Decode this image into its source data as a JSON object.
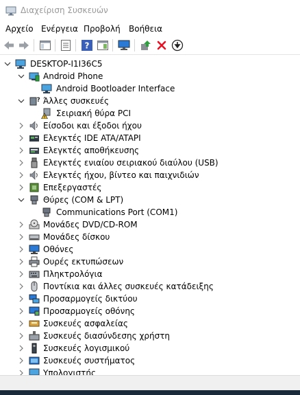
{
  "window": {
    "title": "Διαχείριση Συσκευών"
  },
  "menu": [
    "Αρχείο",
    "Ενέργεια",
    "Προβολή",
    "Βοήθεια"
  ],
  "toolbar": {
    "buttons": [
      "back-icon",
      "forward-icon",
      "tree-view-icon",
      "properties-icon",
      "help-icon",
      "action-pane-icon",
      "monitor-scan-icon",
      "update-driver-icon",
      "uninstall-icon",
      "download-driver-icon"
    ]
  },
  "tree": {
    "root": "DESKTOP-I1I36C5",
    "items": [
      {
        "label": "Android Phone",
        "icon": "android-phone-icon",
        "state": "expanded"
      },
      {
        "label": "Android Bootloader Interface",
        "icon": "monitor-device-icon",
        "state": "child"
      },
      {
        "label": "Άλλες συσκευές",
        "icon": "other-devices-icon",
        "state": "expanded"
      },
      {
        "label": "Σειριακή θύρα PCI",
        "icon": "warning-device-icon",
        "state": "child"
      },
      {
        "label": "Είσοδοι και έξοδοι ήχου",
        "icon": "speaker-icon",
        "state": "collapsed"
      },
      {
        "label": "Ελεγκτές IDE ATA/ATAPI",
        "icon": "ide-controller-icon",
        "state": "collapsed"
      },
      {
        "label": "Ελεγκτές αποθήκευσης",
        "icon": "storage-controller-icon",
        "state": "collapsed"
      },
      {
        "label": "Ελεγκτές ενιαίου σειριακού διαύλου (USB)",
        "icon": "usb-icon",
        "state": "collapsed"
      },
      {
        "label": "Ελεγκτές ήχου, βίντεο και παιχνιδιών",
        "icon": "sound-video-icon",
        "state": "collapsed"
      },
      {
        "label": "Επεξεργαστές",
        "icon": "processor-icon",
        "state": "collapsed"
      },
      {
        "label": "Θύρες (COM & LPT)",
        "icon": "ports-icon",
        "state": "expanded"
      },
      {
        "label": "Communications Port (COM1)",
        "icon": "com-port-icon",
        "state": "child"
      },
      {
        "label": "Μονάδες DVD/CD-ROM",
        "icon": "dvd-drive-icon",
        "state": "collapsed"
      },
      {
        "label": "Μονάδες δίσκου",
        "icon": "disk-drive-icon",
        "state": "collapsed"
      },
      {
        "label": "Οθόνες",
        "icon": "display-monitor-icon",
        "state": "collapsed"
      },
      {
        "label": "Ουρές εκτυπώσεων",
        "icon": "printer-icon",
        "state": "collapsed"
      },
      {
        "label": "Πληκτρολόγια",
        "icon": "keyboard-icon",
        "state": "collapsed"
      },
      {
        "label": "Ποντίκια και άλλες συσκευές κατάδειξης",
        "icon": "mouse-icon",
        "state": "collapsed"
      },
      {
        "label": "Προσαρμογείς δικτύου",
        "icon": "network-adapter-icon",
        "state": "collapsed"
      },
      {
        "label": "Προσαρμογείς οθόνης",
        "icon": "display-adapter-icon",
        "state": "collapsed"
      },
      {
        "label": "Συσκευές ασφαλείας",
        "icon": "security-device-icon",
        "state": "collapsed"
      },
      {
        "label": "Συσκευές διασύνδεσης χρήστη",
        "icon": "hid-icon",
        "state": "collapsed"
      },
      {
        "label": "Συσκευές λογισμικού",
        "icon": "software-device-icon",
        "state": "collapsed"
      },
      {
        "label": "Συσκευές συστήματος",
        "icon": "system-device-icon",
        "state": "collapsed"
      },
      {
        "label": "Υπολογιστής",
        "icon": "computer-icon",
        "state": "collapsed"
      }
    ]
  },
  "colors": {
    "accent": "#2a7ad5",
    "warning": "#f2c12e",
    "delete_red": "#e81123",
    "update_green": "#2e9e3f"
  }
}
